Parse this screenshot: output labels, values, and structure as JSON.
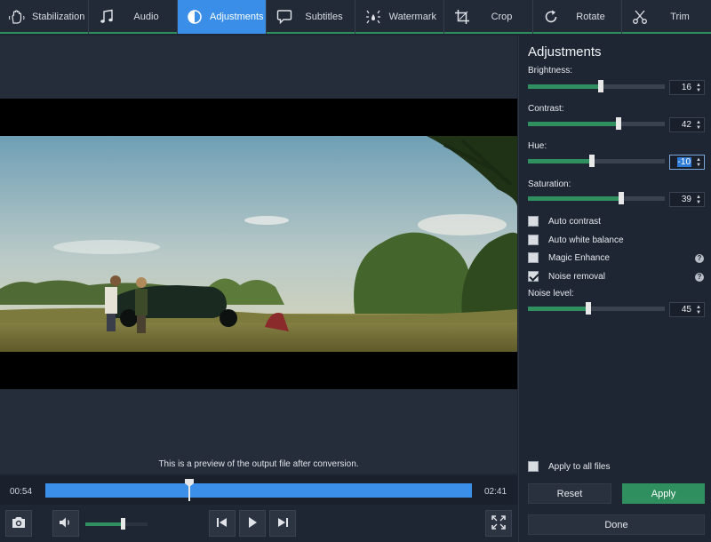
{
  "tabs": [
    {
      "label": "Stabilization",
      "icon": "hand-stabilize-icon",
      "active": false
    },
    {
      "label": "Audio",
      "icon": "music-note-icon",
      "active": false
    },
    {
      "label": "Adjustments",
      "icon": "contrast-circle-icon",
      "active": true
    },
    {
      "label": "Subtitles",
      "icon": "speech-bubble-icon",
      "active": false
    },
    {
      "label": "Watermark",
      "icon": "watermark-icon",
      "active": false
    },
    {
      "label": "Crop",
      "icon": "crop-icon",
      "active": false
    },
    {
      "label": "Rotate",
      "icon": "rotate-icon",
      "active": false
    },
    {
      "label": "Trim",
      "icon": "scissors-icon",
      "active": false
    }
  ],
  "preview": {
    "caption": "This is a preview of the output file after conversion.",
    "current_time": "00:54",
    "total_time": "02:41",
    "playhead_fraction": 0.335,
    "volume_fraction": 0.6
  },
  "panel": {
    "title": "Adjustments",
    "sliders": [
      {
        "label": "Brightness:",
        "value": "16",
        "fraction": 0.53,
        "focused": false
      },
      {
        "label": "Contrast:",
        "value": "42",
        "fraction": 0.66,
        "focused": false
      },
      {
        "label": "Hue:",
        "value": "-10",
        "fraction": 0.47,
        "focused": true
      },
      {
        "label": "Saturation:",
        "value": "39",
        "fraction": 0.68,
        "focused": false
      }
    ],
    "checkboxes": [
      {
        "label": "Auto contrast",
        "checked": false,
        "help": false
      },
      {
        "label": "Auto white balance",
        "checked": false,
        "help": false
      },
      {
        "label": "Magic Enhance",
        "checked": false,
        "help": true
      },
      {
        "label": "Noise removal",
        "checked": true,
        "help": true
      }
    ],
    "noise": {
      "label": "Noise level:",
      "value": "45",
      "fraction": 0.44
    },
    "apply_all_label": "Apply to all files",
    "reset_label": "Reset",
    "apply_label": "Apply",
    "done_label": "Done",
    "help_glyph": "?"
  },
  "colors": {
    "accent_blue": "#3a8ee8",
    "accent_green": "#2f8f5f",
    "background": "#1e2533"
  }
}
